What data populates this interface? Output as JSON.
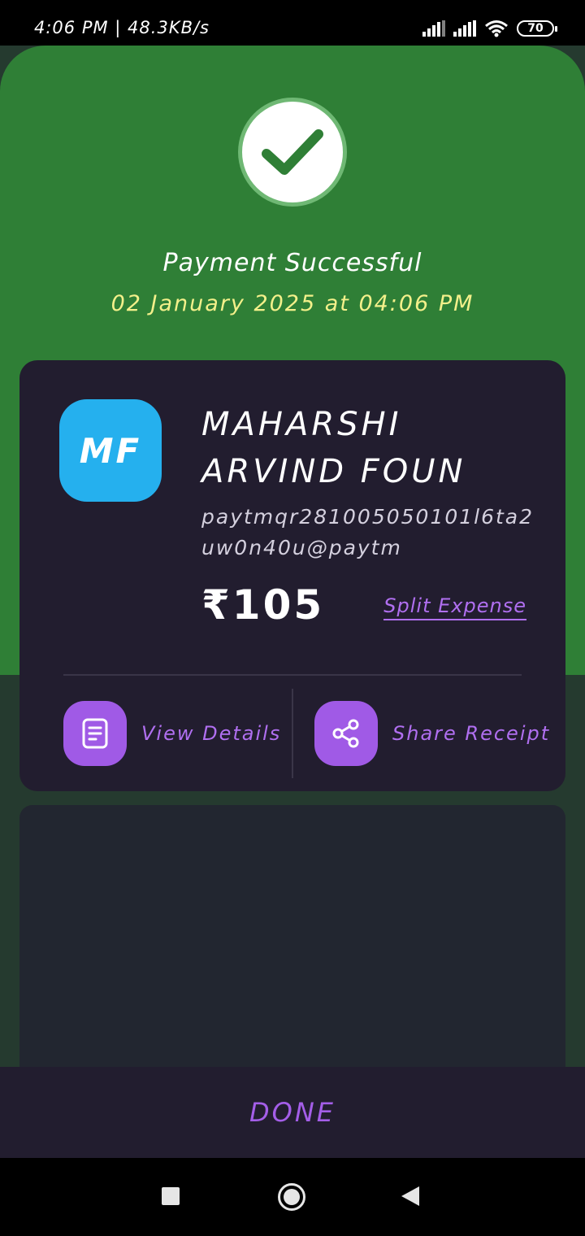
{
  "status_bar": {
    "time_speed": "4:06 PM | 48.3KB/s",
    "battery": "70",
    "icons": [
      "signal-icon",
      "signal-icon",
      "wifi-icon",
      "battery-icon"
    ]
  },
  "header": {
    "title": "Payment Successful",
    "datetime": "02 January 2025 at 04:06 PM",
    "status_icon": "check-icon"
  },
  "card": {
    "avatar_initials": "MF",
    "merchant_name": "MAHARSHI ARVIND FOUN",
    "upi_id": "paytmqr281005050101l6ta2uw0n40u@paytm",
    "amount": "₹105",
    "split_label": "Split Expense",
    "actions": [
      {
        "label": "View Details",
        "icon": "document-icon"
      },
      {
        "label": "Share Receipt",
        "icon": "share-icon"
      }
    ]
  },
  "footer": {
    "done_label": "DONE"
  },
  "colors": {
    "hero_green": "#2f7f36",
    "card_bg": "#221d2f",
    "accent_purple": "#a05ae6",
    "avatar_blue": "#25b0ee",
    "date_yellow": "#f3f08a"
  }
}
